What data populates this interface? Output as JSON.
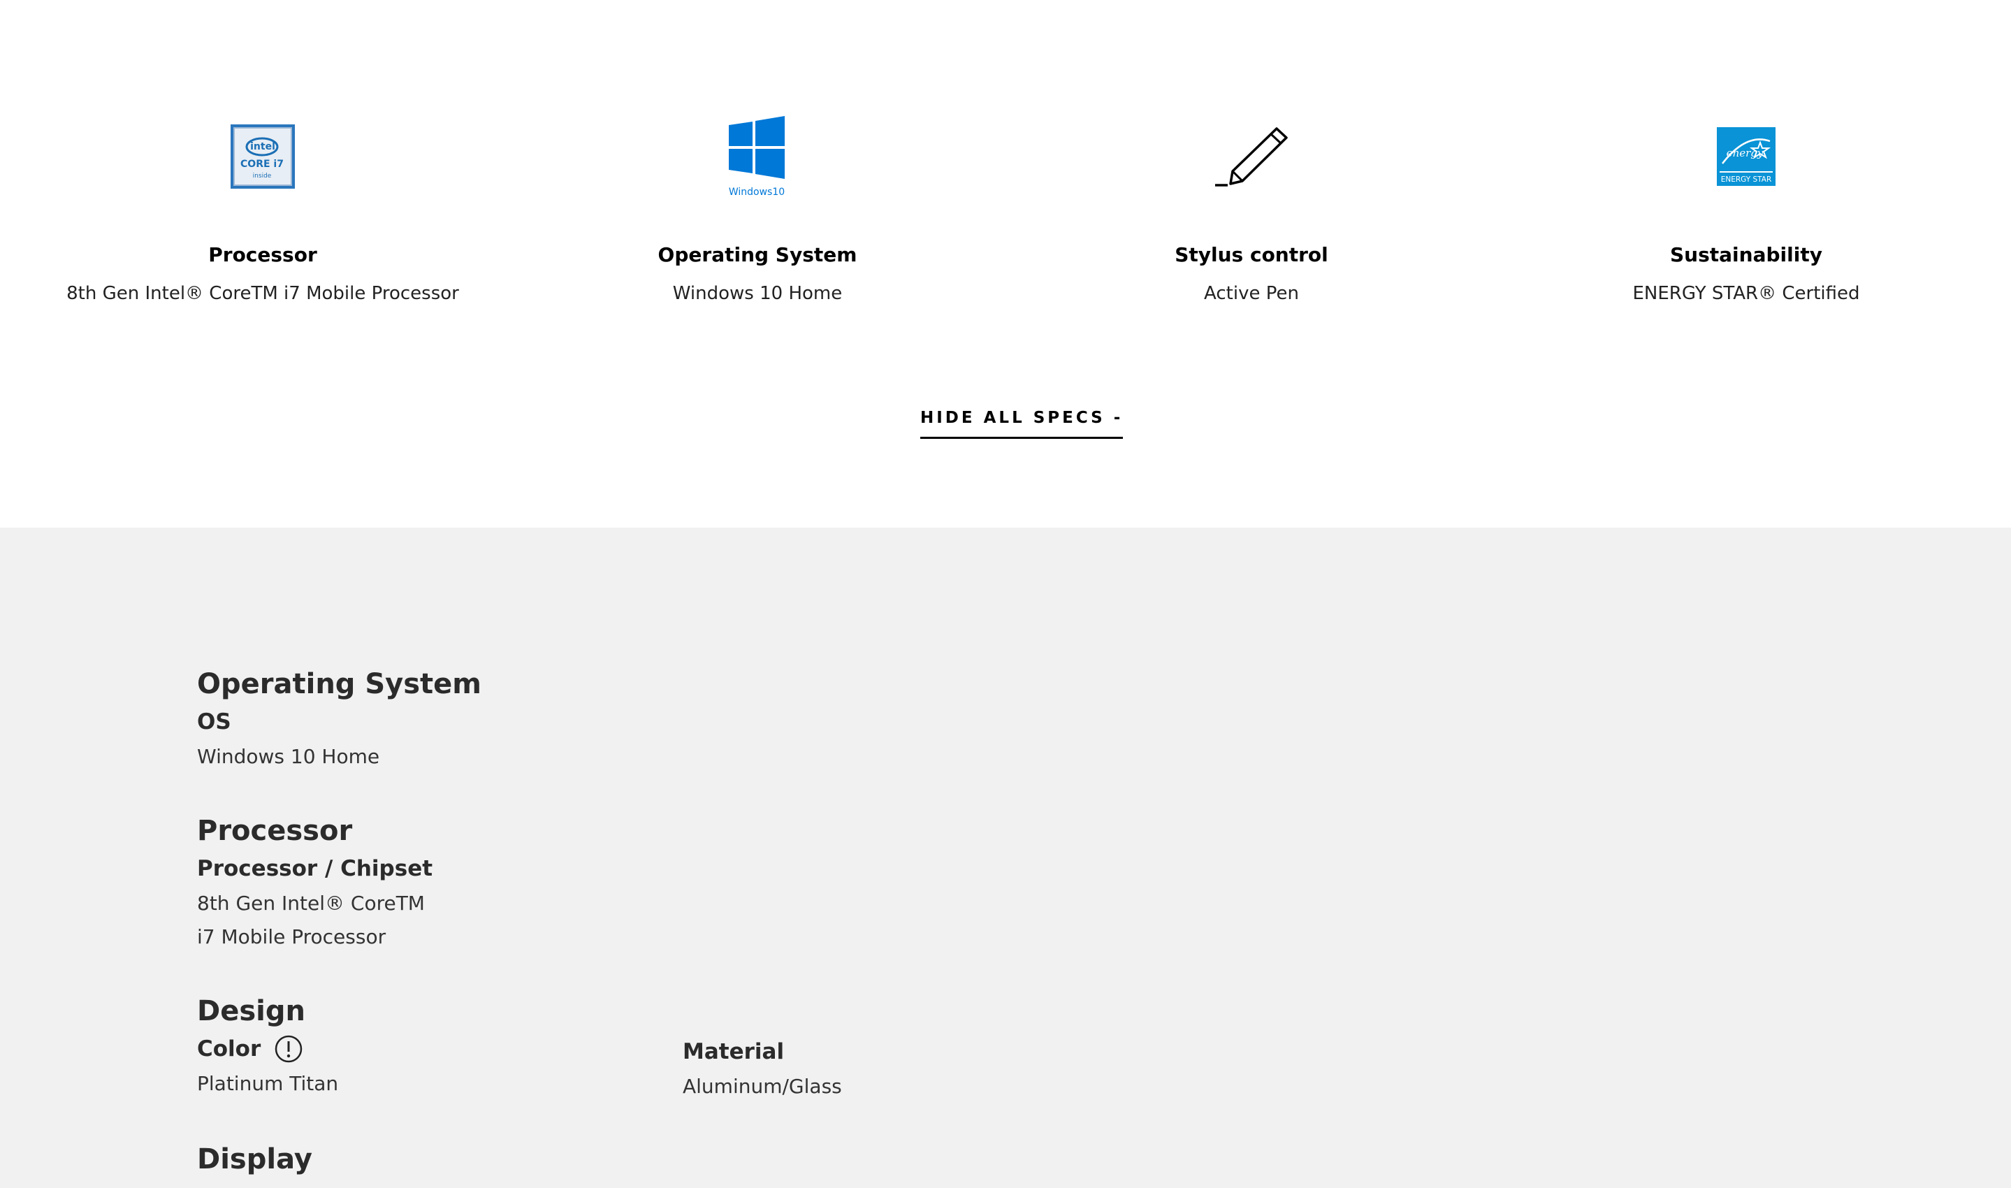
{
  "highlights": [
    {
      "icon": "intel-core-i7-icon",
      "title": "Processor",
      "desc": "8th Gen Intel® CoreTM i7 Mobile Processor"
    },
    {
      "icon": "windows-10-icon",
      "icon_caption": "Windows10",
      "title": "Operating System",
      "desc": "Windows 10 Home"
    },
    {
      "icon": "stylus-pen-icon",
      "title": "Stylus control",
      "desc": "Active Pen"
    },
    {
      "icon": "energy-star-icon",
      "title": "Sustainability",
      "desc": "ENERGY STAR® Certified"
    }
  ],
  "intel_badge": {
    "brand": "intel",
    "line1": "CORE i7",
    "line2": "inside"
  },
  "energy_badge": {
    "script": "energy",
    "label": "ENERGY STAR"
  },
  "hide_specs_label": "HIDE ALL SPECS -",
  "specs": {
    "os": {
      "heading": "Operating System",
      "label": "OS",
      "value": "Windows 10 Home"
    },
    "processor": {
      "heading": "Processor",
      "label": "Processor / Chipset",
      "value": "8th Gen Intel® CoreTM i7 Mobile Processor"
    },
    "design": {
      "heading": "Design",
      "color_label": "Color",
      "color_value": "Platinum Titan",
      "material_label": "Material",
      "material_value": "Aluminum/Glass"
    },
    "display": {
      "heading": "Display"
    }
  },
  "colors": {
    "windows_blue": "#0078d7",
    "energy_blue": "#0a93d6",
    "intel_blue": "#1b6fb5",
    "spec_bg": "#f1f1f1"
  }
}
